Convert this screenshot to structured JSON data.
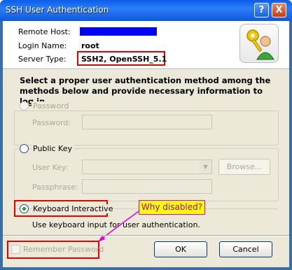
{
  "window": {
    "title": "SSH User Authentication"
  },
  "titlebar_buttons": {
    "help": "?",
    "close": "X"
  },
  "connection": {
    "remote_host_label": "Remote Host:",
    "remote_host_value": "",
    "login_name_label": "Login Name:",
    "login_name_value": "root",
    "server_type_label": "Server Type:",
    "server_type_value": "SSH2, OpenSSH_5.1"
  },
  "instructions": "Select a proper user authentication method among the methods below and provide necessary information to log in.",
  "methods": {
    "password": {
      "label": "Password",
      "field_label": "Password:",
      "value": ""
    },
    "public_key": {
      "label": "Public Key",
      "user_key_label": "User Key:",
      "user_key_value": "",
      "browse_label": "Browse...",
      "passphrase_label": "Passphrase:",
      "passphrase_value": ""
    },
    "keyboard_interactive": {
      "label": "Keyboard Interactive",
      "description": "Use keyboard input for user authentication."
    }
  },
  "remember_password_label": "Remember Password",
  "annotation_callout": "Why disabled?",
  "buttons": {
    "ok": "OK",
    "cancel": "Cancel"
  },
  "colors": {
    "highlight_red": "#e60000",
    "callout_bg": "#ffff00",
    "callout_text": "#b000b0",
    "title_bar": "#0a5de8"
  }
}
